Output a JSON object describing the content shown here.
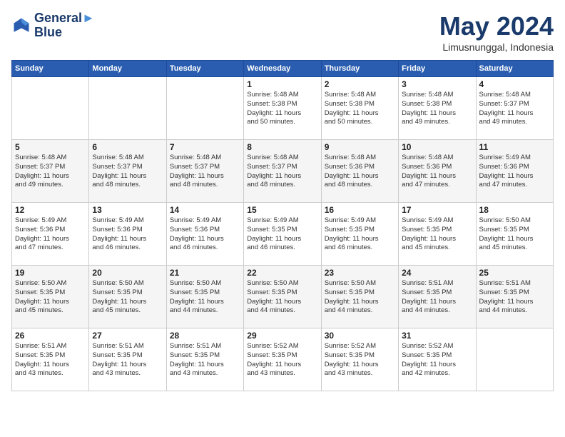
{
  "header": {
    "logo_line1": "General",
    "logo_line2": "Blue",
    "month": "May 2024",
    "location": "Limusnunggal, Indonesia"
  },
  "weekdays": [
    "Sunday",
    "Monday",
    "Tuesday",
    "Wednesday",
    "Thursday",
    "Friday",
    "Saturday"
  ],
  "weeks": [
    [
      {
        "day": "",
        "info": ""
      },
      {
        "day": "",
        "info": ""
      },
      {
        "day": "",
        "info": ""
      },
      {
        "day": "1",
        "info": "Sunrise: 5:48 AM\nSunset: 5:38 PM\nDaylight: 11 hours\nand 50 minutes."
      },
      {
        "day": "2",
        "info": "Sunrise: 5:48 AM\nSunset: 5:38 PM\nDaylight: 11 hours\nand 50 minutes."
      },
      {
        "day": "3",
        "info": "Sunrise: 5:48 AM\nSunset: 5:38 PM\nDaylight: 11 hours\nand 49 minutes."
      },
      {
        "day": "4",
        "info": "Sunrise: 5:48 AM\nSunset: 5:37 PM\nDaylight: 11 hours\nand 49 minutes."
      }
    ],
    [
      {
        "day": "5",
        "info": "Sunrise: 5:48 AM\nSunset: 5:37 PM\nDaylight: 11 hours\nand 49 minutes."
      },
      {
        "day": "6",
        "info": "Sunrise: 5:48 AM\nSunset: 5:37 PM\nDaylight: 11 hours\nand 48 minutes."
      },
      {
        "day": "7",
        "info": "Sunrise: 5:48 AM\nSunset: 5:37 PM\nDaylight: 11 hours\nand 48 minutes."
      },
      {
        "day": "8",
        "info": "Sunrise: 5:48 AM\nSunset: 5:37 PM\nDaylight: 11 hours\nand 48 minutes."
      },
      {
        "day": "9",
        "info": "Sunrise: 5:48 AM\nSunset: 5:36 PM\nDaylight: 11 hours\nand 48 minutes."
      },
      {
        "day": "10",
        "info": "Sunrise: 5:48 AM\nSunset: 5:36 PM\nDaylight: 11 hours\nand 47 minutes."
      },
      {
        "day": "11",
        "info": "Sunrise: 5:49 AM\nSunset: 5:36 PM\nDaylight: 11 hours\nand 47 minutes."
      }
    ],
    [
      {
        "day": "12",
        "info": "Sunrise: 5:49 AM\nSunset: 5:36 PM\nDaylight: 11 hours\nand 47 minutes."
      },
      {
        "day": "13",
        "info": "Sunrise: 5:49 AM\nSunset: 5:36 PM\nDaylight: 11 hours\nand 46 minutes."
      },
      {
        "day": "14",
        "info": "Sunrise: 5:49 AM\nSunset: 5:36 PM\nDaylight: 11 hours\nand 46 minutes."
      },
      {
        "day": "15",
        "info": "Sunrise: 5:49 AM\nSunset: 5:35 PM\nDaylight: 11 hours\nand 46 minutes."
      },
      {
        "day": "16",
        "info": "Sunrise: 5:49 AM\nSunset: 5:35 PM\nDaylight: 11 hours\nand 46 minutes."
      },
      {
        "day": "17",
        "info": "Sunrise: 5:49 AM\nSunset: 5:35 PM\nDaylight: 11 hours\nand 45 minutes."
      },
      {
        "day": "18",
        "info": "Sunrise: 5:50 AM\nSunset: 5:35 PM\nDaylight: 11 hours\nand 45 minutes."
      }
    ],
    [
      {
        "day": "19",
        "info": "Sunrise: 5:50 AM\nSunset: 5:35 PM\nDaylight: 11 hours\nand 45 minutes."
      },
      {
        "day": "20",
        "info": "Sunrise: 5:50 AM\nSunset: 5:35 PM\nDaylight: 11 hours\nand 45 minutes."
      },
      {
        "day": "21",
        "info": "Sunrise: 5:50 AM\nSunset: 5:35 PM\nDaylight: 11 hours\nand 44 minutes."
      },
      {
        "day": "22",
        "info": "Sunrise: 5:50 AM\nSunset: 5:35 PM\nDaylight: 11 hours\nand 44 minutes."
      },
      {
        "day": "23",
        "info": "Sunrise: 5:50 AM\nSunset: 5:35 PM\nDaylight: 11 hours\nand 44 minutes."
      },
      {
        "day": "24",
        "info": "Sunrise: 5:51 AM\nSunset: 5:35 PM\nDaylight: 11 hours\nand 44 minutes."
      },
      {
        "day": "25",
        "info": "Sunrise: 5:51 AM\nSunset: 5:35 PM\nDaylight: 11 hours\nand 44 minutes."
      }
    ],
    [
      {
        "day": "26",
        "info": "Sunrise: 5:51 AM\nSunset: 5:35 PM\nDaylight: 11 hours\nand 43 minutes."
      },
      {
        "day": "27",
        "info": "Sunrise: 5:51 AM\nSunset: 5:35 PM\nDaylight: 11 hours\nand 43 minutes."
      },
      {
        "day": "28",
        "info": "Sunrise: 5:51 AM\nSunset: 5:35 PM\nDaylight: 11 hours\nand 43 minutes."
      },
      {
        "day": "29",
        "info": "Sunrise: 5:52 AM\nSunset: 5:35 PM\nDaylight: 11 hours\nand 43 minutes."
      },
      {
        "day": "30",
        "info": "Sunrise: 5:52 AM\nSunset: 5:35 PM\nDaylight: 11 hours\nand 43 minutes."
      },
      {
        "day": "31",
        "info": "Sunrise: 5:52 AM\nSunset: 5:35 PM\nDaylight: 11 hours\nand 42 minutes."
      },
      {
        "day": "",
        "info": ""
      }
    ]
  ]
}
